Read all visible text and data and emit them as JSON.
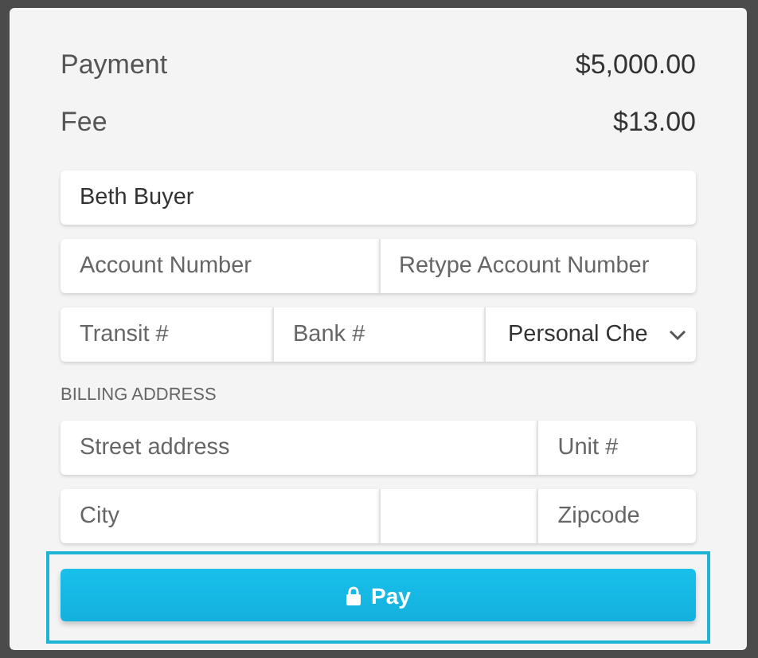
{
  "summary": [
    {
      "label": "Payment",
      "amount": "$5,000.00"
    },
    {
      "label": "Fee",
      "amount": "$13.00"
    }
  ],
  "account_rows": [
    [
      {
        "kind": "input",
        "value": "Beth Buyer"
      }
    ],
    [
      {
        "kind": "input",
        "placeholder": "Account Number"
      },
      {
        "kind": "input",
        "placeholder": "Retype Account Number"
      }
    ],
    [
      {
        "kind": "input",
        "placeholder": "Transit #"
      },
      {
        "kind": "input",
        "placeholder": "Bank #"
      },
      {
        "kind": "select",
        "value": "Personal Che"
      }
    ]
  ],
  "billing_label": "BILLING ADDRESS",
  "address_rows": [
    [
      {
        "kind": "input",
        "placeholder": "Street address"
      },
      {
        "kind": "input",
        "placeholder": "Unit #"
      }
    ],
    [
      {
        "kind": "input",
        "placeholder": "City"
      },
      {
        "kind": "input"
      },
      {
        "kind": "input",
        "placeholder": "Zipcode"
      }
    ]
  ],
  "pay_button": {
    "label": "Pay",
    "focused": true
  }
}
